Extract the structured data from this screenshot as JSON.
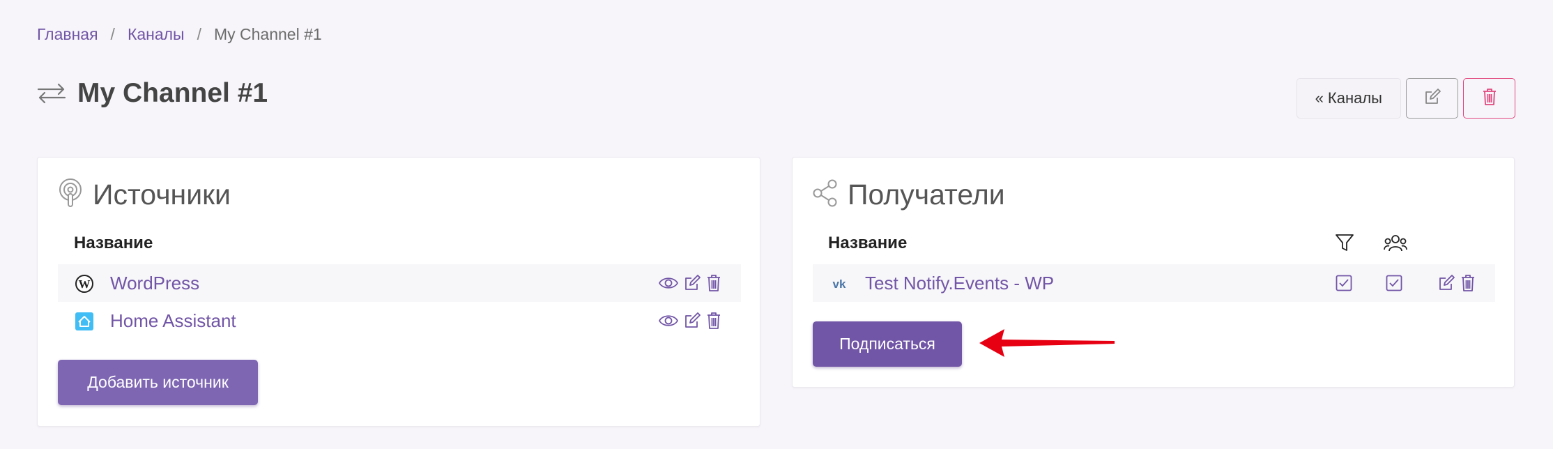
{
  "breadcrumb": {
    "home": "Главная",
    "channels": "Каналы",
    "current": "My Channel #1"
  },
  "header": {
    "title": "My Channel #1",
    "back_label": "« Каналы"
  },
  "sources": {
    "title": "Источники",
    "column_name": "Название",
    "rows": [
      {
        "name": "WordPress",
        "icon": "wordpress-icon"
      },
      {
        "name": "Home Assistant",
        "icon": "home-assistant-icon"
      }
    ],
    "add_label": "Добавить источник"
  },
  "recipients": {
    "title": "Получатели",
    "column_name": "Название",
    "rows": [
      {
        "name": "Test Notify.Events - WP",
        "icon": "vk-icon",
        "filter": true,
        "group": true
      }
    ],
    "subscribe_label": "Подписаться"
  },
  "colors": {
    "accent": "#7e66b3",
    "link": "#7155a6",
    "danger": "#e0467c",
    "annotation_arrow": "#e60012"
  }
}
